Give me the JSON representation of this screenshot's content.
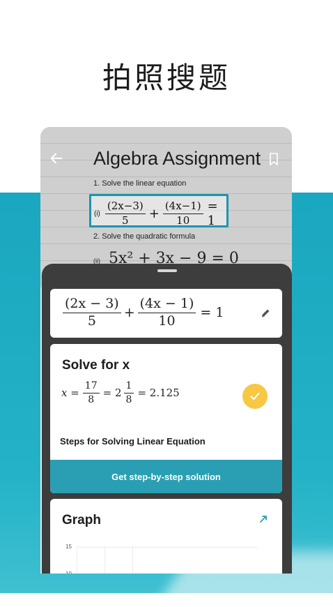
{
  "headline": "拍照搜题",
  "paper": {
    "title": "Algebra Assignment",
    "question1": "1. Solve the linear equation",
    "question2": "2. Solve the quadratic formula",
    "scan_label": "(i)",
    "scan_equation": {
      "frac1_num": "(2x−3)",
      "frac1_den": "5",
      "plus": "+",
      "frac2_num": "(4x−1)",
      "frac2_den": "10",
      "rhs": "= 1"
    },
    "q3_label": "(ii)",
    "q3_equation": "5x² + 3x − 9 = 0"
  },
  "equation_card": {
    "frac1_num": "(2x − 3)",
    "frac1_den": "5",
    "plus": "+",
    "frac2_num": "(4x − 1)",
    "frac2_den": "10",
    "rhs": "= 1"
  },
  "solve_card": {
    "title": "Solve for x",
    "lhs": "x =",
    "frac1_num": "17",
    "frac1_den": "8",
    "eq2": "= 2",
    "mixed_num": "1",
    "mixed_den": "8",
    "result": "= 2.125",
    "steps_label": "Steps for Solving Linear Equation",
    "cta_label": "Get step-by-step solution"
  },
  "graph_card": {
    "title": "Graph",
    "y_ticks": [
      "15",
      "10"
    ]
  },
  "colors": {
    "teal": "#1aa7bf",
    "cta": "#2a9fb3",
    "check": "#f7c843",
    "sheet": "#3d3d3d"
  },
  "icons": [
    "back-arrow-icon",
    "bookmark-icon",
    "pencil-icon",
    "check-icon",
    "expand-icon"
  ]
}
